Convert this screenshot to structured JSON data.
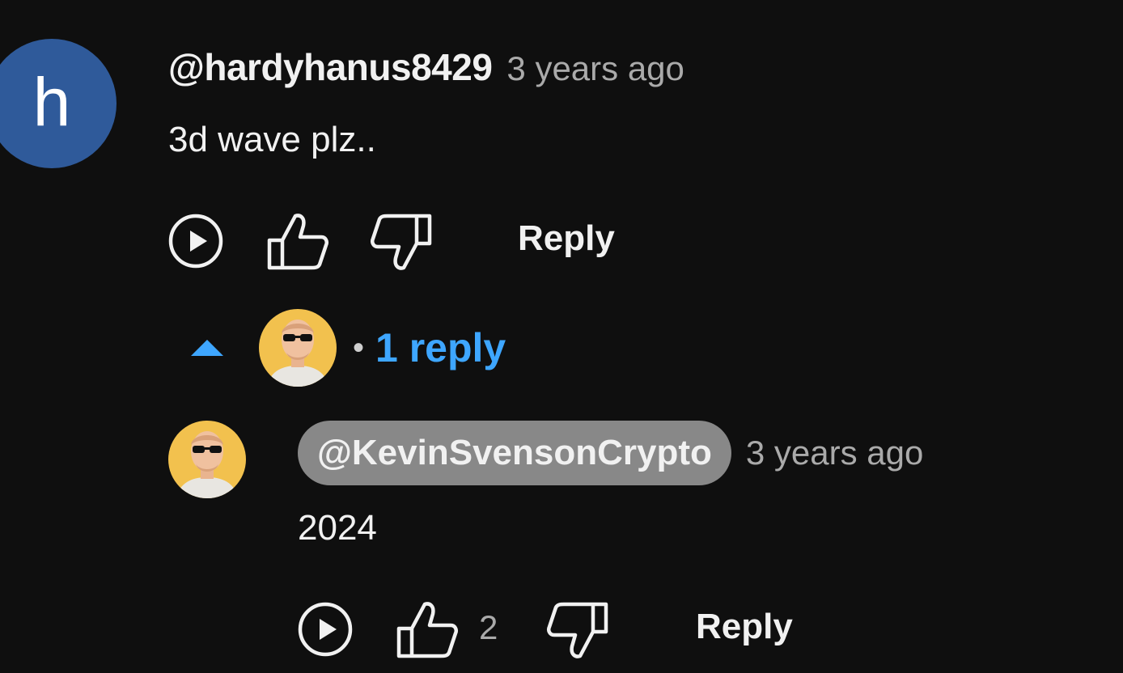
{
  "comment": {
    "avatar_letter": "h",
    "avatar_color": "#2f5a9a",
    "author": "@hardyhanus8429",
    "time": "3 years ago",
    "text": "3d wave plz..",
    "reply_label": "Reply"
  },
  "replies_toggle": {
    "bullet": "•",
    "label": "1 reply",
    "color": "#3ea6ff"
  },
  "reply": {
    "author": "@KevinSvensonCrypto",
    "time": "3 years ago",
    "text": "2024",
    "like_count": "2",
    "reply_label": "Reply"
  }
}
